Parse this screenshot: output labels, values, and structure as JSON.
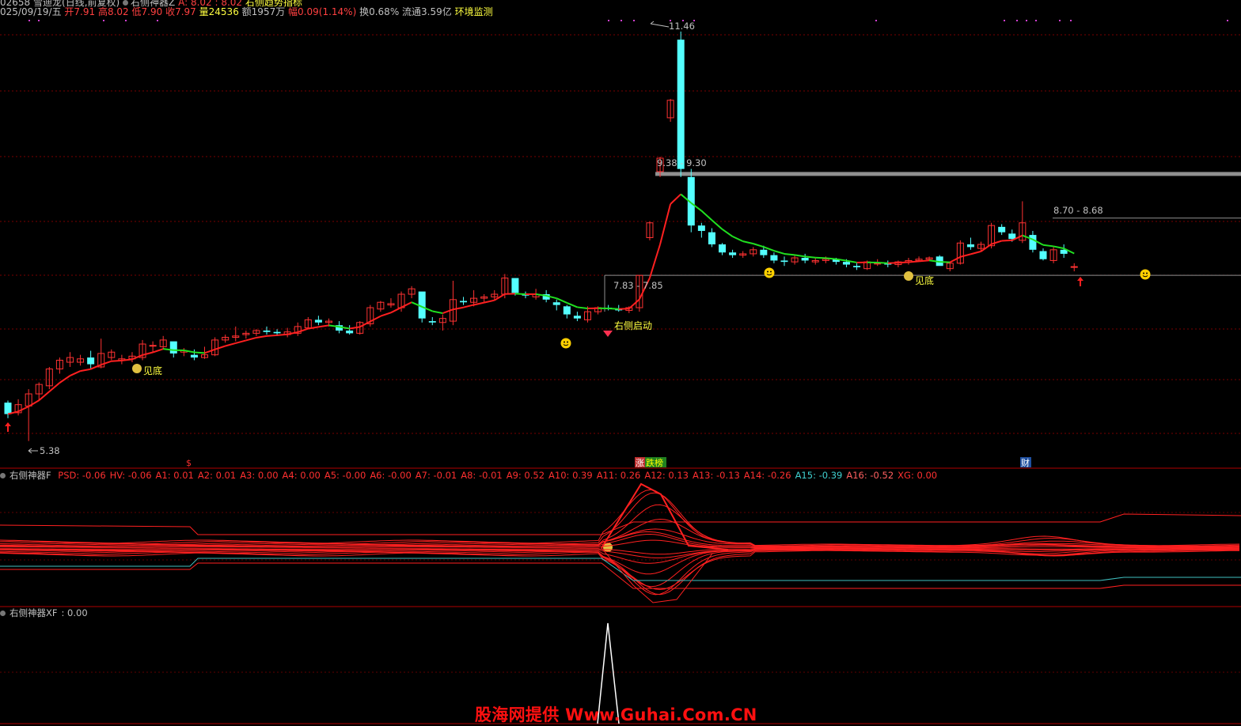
{
  "header": {
    "line1": {
      "code": "02658",
      "name_mode": "雪迪龙(日线,前复权)",
      "indicator": "右侧神器Z",
      "a_values": "A: 8.02 : 8.02",
      "right_label": "右侧趋势指标"
    },
    "line2": {
      "date": "025/09/19/五",
      "open": "开7.91",
      "high": "高8.02",
      "low": "低7.90",
      "close": "收7.97",
      "volume": "量24536",
      "amount": "额1957万",
      "change": "幅0.09(1.14%)",
      "turnover": "换0.68%",
      "float_cap": "流通3.59亿",
      "env_label": "环境监测"
    }
  },
  "main_panel": {
    "price_range": [
      5.0,
      11.6
    ],
    "annotations": {
      "low_label": "5.38",
      "high_label": "11.46",
      "zone1": "9.38 - 9.30",
      "zone2": "8.70 - 8.68",
      "zone3": "7.83 - 7.85",
      "signal_bottom_1": "见底",
      "signal_bottom_2": "见底",
      "signal_start": "右侧启动"
    },
    "event_labels": {
      "dollar": "$",
      "limit_up": "涨",
      "rank": "跌榜",
      "finance": "财"
    },
    "colors": {
      "up": "#ff3232",
      "down": "#54ffff",
      "ma_up": "#ff2020",
      "ma_down": "#20e020",
      "grid": "#7a0000",
      "zone_bar": "#909090"
    },
    "chart_data": {
      "type": "candlestick",
      "bars": 104,
      "series_name": "",
      "ohlc": [
        [
          5.95,
          5.98,
          5.72,
          5.78
        ],
        [
          5.8,
          6.0,
          5.76,
          5.92
        ],
        [
          5.9,
          6.15,
          5.38,
          6.08
        ],
        [
          6.08,
          6.25,
          5.98,
          6.22
        ],
        [
          6.2,
          6.48,
          6.15,
          6.45
        ],
        [
          6.45,
          6.62,
          6.38,
          6.58
        ],
        [
          6.55,
          6.7,
          6.48,
          6.62
        ],
        [
          6.55,
          6.66,
          6.5,
          6.6
        ],
        [
          6.62,
          6.72,
          6.45,
          6.52
        ],
        [
          6.48,
          6.9,
          6.46,
          6.68
        ],
        [
          6.62,
          6.74,
          6.58,
          6.7
        ],
        [
          6.58,
          6.66,
          6.52,
          6.6
        ],
        [
          6.6,
          6.7,
          6.55,
          6.64
        ],
        [
          6.62,
          6.88,
          6.58,
          6.82
        ],
        [
          6.8,
          6.86,
          6.7,
          6.8
        ],
        [
          6.78,
          6.94,
          6.74,
          6.88
        ],
        [
          6.86,
          6.84,
          6.62,
          6.68
        ],
        [
          6.7,
          6.76,
          6.64,
          6.72
        ],
        [
          6.66,
          6.74,
          6.58,
          6.62
        ],
        [
          6.62,
          6.78,
          6.6,
          6.66
        ],
        [
          6.66,
          6.92,
          6.64,
          6.88
        ],
        [
          6.88,
          6.96,
          6.84,
          6.92
        ],
        [
          6.92,
          7.08,
          6.86,
          6.94
        ],
        [
          6.96,
          7.02,
          6.9,
          6.98
        ],
        [
          6.98,
          7.04,
          6.94,
          7.02
        ],
        [
          7.02,
          7.08,
          6.96,
          7.0
        ],
        [
          7.0,
          7.04,
          6.94,
          6.98
        ],
        [
          6.96,
          7.06,
          6.92,
          7.0
        ],
        [
          6.98,
          7.14,
          6.94,
          7.08
        ],
        [
          7.06,
          7.22,
          7.04,
          7.18
        ],
        [
          7.18,
          7.24,
          7.1,
          7.14
        ],
        [
          7.14,
          7.2,
          7.08,
          7.16
        ],
        [
          7.1,
          7.16,
          6.98,
          7.02
        ],
        [
          7.02,
          7.1,
          6.96,
          6.98
        ],
        [
          6.98,
          7.16,
          6.96,
          7.14
        ],
        [
          7.12,
          7.4,
          7.08,
          7.36
        ],
        [
          7.34,
          7.46,
          7.3,
          7.44
        ],
        [
          7.4,
          7.5,
          7.36,
          7.42
        ],
        [
          7.36,
          7.6,
          7.3,
          7.56
        ],
        [
          7.56,
          7.68,
          7.5,
          7.64
        ],
        [
          7.6,
          7.4,
          7.14,
          7.2
        ],
        [
          7.16,
          7.22,
          7.1,
          7.14
        ],
        [
          7.14,
          7.26,
          7.02,
          7.2
        ],
        [
          7.16,
          7.76,
          7.1,
          7.48
        ],
        [
          7.46,
          7.52,
          7.4,
          7.44
        ],
        [
          7.44,
          7.62,
          7.38,
          7.5
        ],
        [
          7.5,
          7.56,
          7.44,
          7.52
        ],
        [
          7.52,
          7.62,
          7.48,
          7.56
        ],
        [
          7.56,
          7.86,
          7.5,
          7.8
        ],
        [
          7.8,
          7.7,
          7.54,
          7.58
        ],
        [
          7.56,
          7.6,
          7.5,
          7.54
        ],
        [
          7.52,
          7.64,
          7.48,
          7.56
        ],
        [
          7.56,
          7.62,
          7.44,
          7.48
        ],
        [
          7.44,
          7.48,
          7.32,
          7.4
        ],
        [
          7.38,
          7.4,
          7.2,
          7.26
        ],
        [
          7.24,
          7.3,
          7.16,
          7.2
        ],
        [
          7.18,
          7.38,
          7.14,
          7.3
        ],
        [
          7.3,
          7.38,
          7.26,
          7.36
        ],
        [
          7.36,
          7.4,
          7.32,
          7.34
        ],
        [
          7.34,
          7.4,
          7.3,
          7.32
        ],
        [
          7.32,
          7.38,
          7.28,
          7.36
        ],
        [
          7.36,
          7.84,
          7.3,
          7.84
        ],
        [
          8.4,
          8.64,
          8.36,
          8.62
        ],
        [
          9.38,
          9.6,
          9.3,
          9.58
        ],
        [
          10.18,
          10.46,
          10.12,
          10.44
        ],
        [
          11.34,
          11.46,
          9.3,
          9.42
        ],
        [
          9.3,
          9.42,
          8.48,
          8.58
        ],
        [
          8.58,
          8.62,
          8.4,
          8.5
        ],
        [
          8.48,
          8.54,
          8.26,
          8.3
        ],
        [
          8.3,
          8.32,
          8.14,
          8.18
        ],
        [
          8.18,
          8.22,
          8.1,
          8.14
        ],
        [
          8.14,
          8.2,
          8.1,
          8.16
        ],
        [
          8.16,
          8.26,
          8.12,
          8.22
        ],
        [
          8.22,
          8.28,
          8.1,
          8.14
        ],
        [
          8.14,
          8.18,
          8.02,
          8.06
        ],
        [
          8.06,
          8.12,
          7.98,
          8.04
        ],
        [
          8.04,
          8.14,
          8.0,
          8.1
        ],
        [
          8.1,
          8.16,
          8.02,
          8.06
        ],
        [
          8.04,
          8.1,
          8.0,
          8.06
        ],
        [
          8.06,
          8.12,
          8.02,
          8.08
        ],
        [
          8.08,
          8.1,
          8.0,
          8.04
        ],
        [
          8.04,
          8.08,
          7.96,
          8.0
        ],
        [
          7.98,
          8.02,
          7.92,
          7.96
        ],
        [
          7.94,
          8.06,
          7.92,
          8.04
        ],
        [
          8.02,
          8.08,
          7.98,
          8.02
        ],
        [
          8.02,
          8.06,
          7.96,
          8.0
        ],
        [
          8.0,
          8.06,
          7.96,
          8.04
        ],
        [
          8.04,
          8.1,
          8.0,
          8.06
        ],
        [
          8.06,
          8.12,
          8.04,
          8.08
        ],
        [
          8.08,
          8.12,
          8.06,
          8.1
        ],
        [
          8.12,
          8.14,
          8.0,
          7.98
        ],
        [
          7.94,
          8.04,
          7.9,
          8.02
        ],
        [
          8.02,
          8.36,
          8.0,
          8.32
        ],
        [
          8.3,
          8.4,
          8.22,
          8.26
        ],
        [
          8.24,
          8.34,
          8.2,
          8.3
        ],
        [
          8.28,
          8.62,
          8.24,
          8.58
        ],
        [
          8.56,
          8.6,
          8.44,
          8.48
        ],
        [
          8.46,
          8.52,
          8.34,
          8.38
        ],
        [
          8.36,
          8.94,
          8.32,
          8.62
        ],
        [
          8.44,
          8.5,
          8.18,
          8.22
        ],
        [
          8.2,
          8.24,
          8.06,
          8.08
        ],
        [
          8.06,
          8.26,
          8.02,
          8.22
        ],
        [
          8.22,
          8.3,
          8.1,
          8.16
        ],
        [
          7.97,
          8.02,
          7.9,
          7.97
        ]
      ]
    }
  },
  "panel2": {
    "title": "右侧神器F",
    "values": [
      {
        "name": "PSD",
        "value": "-0.06"
      },
      {
        "name": "HV",
        "value": "-0.06"
      },
      {
        "name": "A1",
        "value": "0.01"
      },
      {
        "name": "A2",
        "value": "0.01"
      },
      {
        "name": "A3",
        "value": "0.00"
      },
      {
        "name": "A4",
        "value": "0.00"
      },
      {
        "name": "A5",
        "value": "-0.00"
      },
      {
        "name": "A6",
        "value": "-0.00"
      },
      {
        "name": "A7",
        "value": "-0.01"
      },
      {
        "name": "A8",
        "value": "-0.01"
      },
      {
        "name": "A9",
        "value": "0.52"
      },
      {
        "name": "A10",
        "value": "0.39"
      },
      {
        "name": "A11",
        "value": "0.26"
      },
      {
        "name": "A12",
        "value": "0.13"
      },
      {
        "name": "A13",
        "value": "-0.13"
      },
      {
        "name": "A14",
        "value": "-0.26"
      },
      {
        "name": "A15",
        "value": "-0.39"
      },
      {
        "name": "A16",
        "value": "-0.52"
      },
      {
        "name": "XG",
        "value": "0.00"
      }
    ]
  },
  "panel3": {
    "title": "右侧神器XF",
    "value": ": 0.00"
  },
  "watermark": "股海网提供 Www.Guhai.Com.CN"
}
